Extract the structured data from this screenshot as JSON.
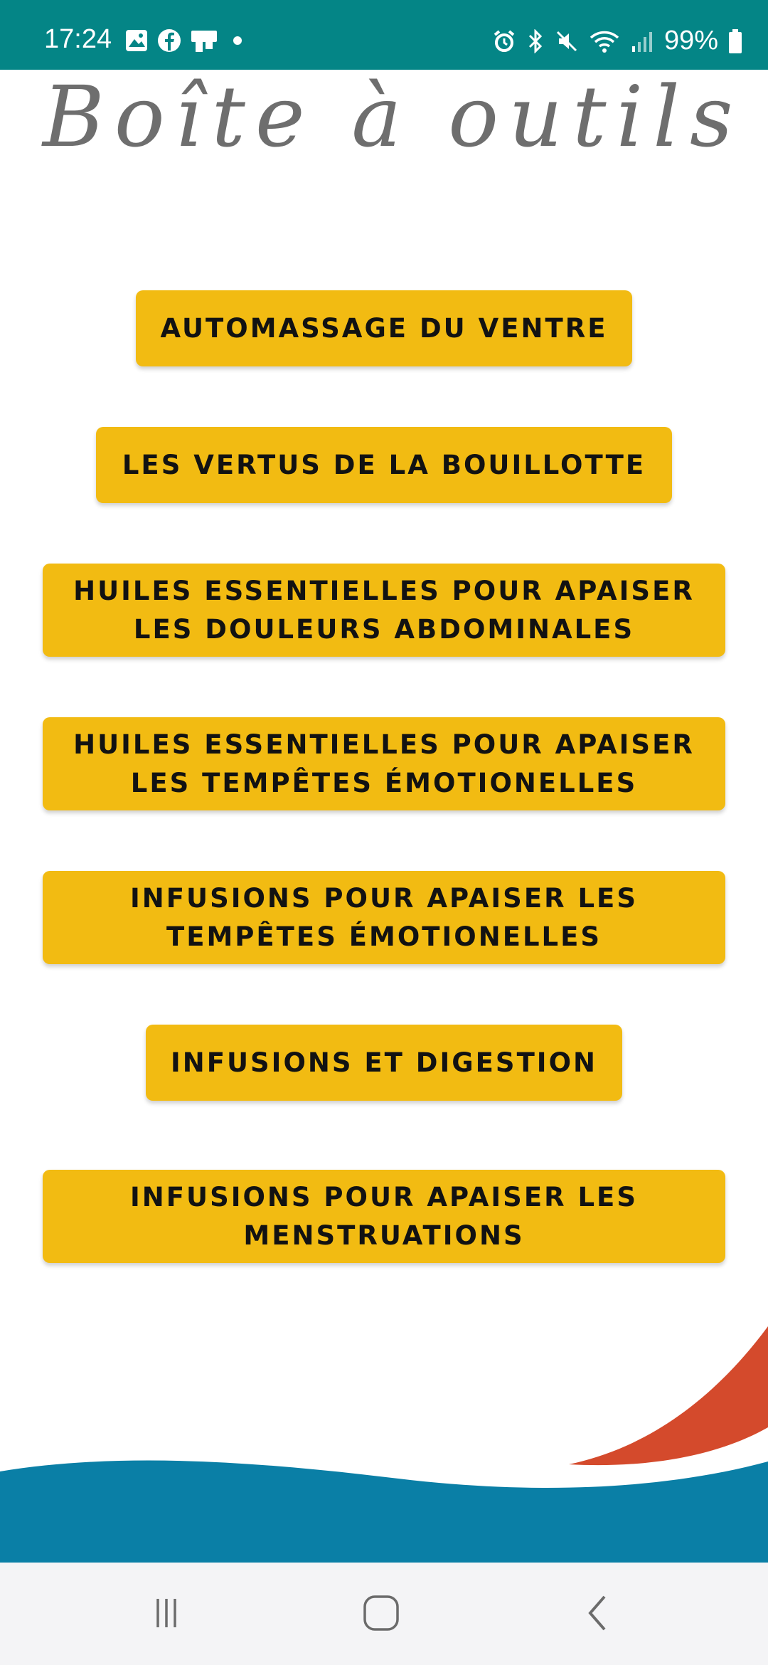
{
  "status_bar": {
    "time": "17:24",
    "battery": "99%",
    "left_icons": [
      "gallery-icon",
      "facebook-icon",
      "app-notification-icon",
      "dot-icon"
    ],
    "right_icons": [
      "alarm-icon",
      "bluetooth-icon",
      "mute-icon",
      "wifi-icon",
      "signal-icon",
      "battery-icon"
    ]
  },
  "page": {
    "title": "Boîte à outils"
  },
  "menu": [
    {
      "id": "automassage-du-ventre",
      "lines": [
        "AUTOMASSAGE DU VENTRE"
      ]
    },
    {
      "id": "vertus-bouillotte",
      "lines": [
        "LES VERTUS DE LA BOUILLOTTE"
      ]
    },
    {
      "id": "huiles-douleurs-abdominales",
      "lines": [
        "HUILES ESSENTIELLES POUR APAISER",
        "LES DOULEURS ABDOMINALES"
      ]
    },
    {
      "id": "huiles-tempetes-emotionelles",
      "lines": [
        "HUILES ESSENTIELLES POUR APAISER",
        "LES TEMPÊTES ÉMOTIONELLES"
      ]
    },
    {
      "id": "infusions-tempetes-emotionelles",
      "lines": [
        "INFUSIONS POUR APAISER LES",
        "TEMPÊTES ÉMOTIONELLES"
      ]
    },
    {
      "id": "infusions-digestion",
      "lines": [
        "INFUSIONS ET DIGESTION"
      ]
    },
    {
      "id": "infusions-menstruations",
      "lines": [
        "INFUSIONS POUR APAISER LES",
        "MENSTRUATIONS"
      ]
    }
  ],
  "colors": {
    "status_bar": "#048586",
    "button": "#f2bb12",
    "button_text": "#121212",
    "title": "#6e6e6e",
    "wave_blue": "#0a7fa6",
    "wave_red": "#d44a2c",
    "nav_bar": "#f4f4f6"
  },
  "nav_bar": {
    "icons": [
      "recent-apps-icon",
      "home-icon",
      "back-icon"
    ]
  }
}
